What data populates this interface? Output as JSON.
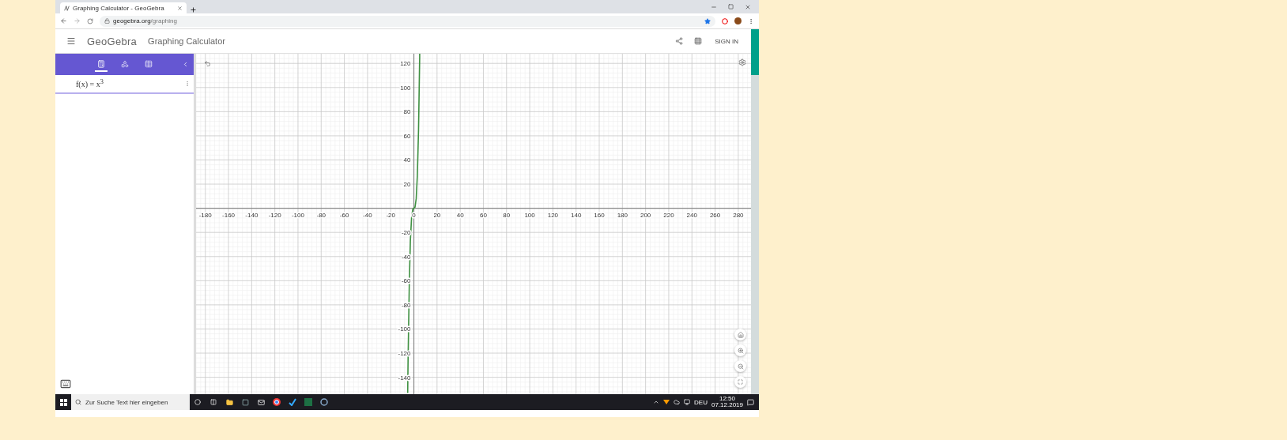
{
  "browser": {
    "tab_title": "Graphing Calculator - GeoGebra",
    "url_host": "geogebra.org",
    "url_path": "/graphing"
  },
  "app": {
    "logo": "GeoGebra",
    "title": "Graphing Calculator",
    "sign_in": "SIGN IN"
  },
  "sidebar": {
    "tabs": [
      {
        "kind": "algebra",
        "selected": true
      },
      {
        "kind": "tools",
        "selected": false
      },
      {
        "kind": "table",
        "selected": false
      }
    ],
    "expressions": [
      {
        "text": "f(x) = x$^{3}$"
      }
    ]
  },
  "graph": {
    "chart_data": {
      "type": "line",
      "grid": true,
      "x": [
        -5.35,
        -5,
        -4,
        -3,
        -2,
        -1,
        0,
        1,
        2,
        3,
        4,
        5,
        5.04
      ],
      "values": [
        -153.1,
        -125,
        -64,
        -27,
        -8,
        -1,
        0,
        1,
        8,
        27,
        64,
        125,
        128
      ],
      "xlim": [
        -188,
        291
      ],
      "ylim": [
        -154,
        128
      ],
      "xticks": [
        -180,
        -160,
        -140,
        -120,
        -100,
        -80,
        -60,
        -40,
        -20,
        0,
        20,
        40,
        60,
        80,
        100,
        120,
        140,
        160,
        180,
        200,
        220,
        240,
        260,
        280
      ],
      "yticks": [
        -140,
        -120,
        -100,
        -80,
        -60,
        -40,
        -20,
        20,
        40,
        60,
        80,
        100,
        120
      ]
    }
  },
  "taskbar": {
    "search_placeholder": "Zur Suche Text hier eingeben",
    "language": "DEU",
    "time": "12:50",
    "date": "07.12.2019"
  }
}
